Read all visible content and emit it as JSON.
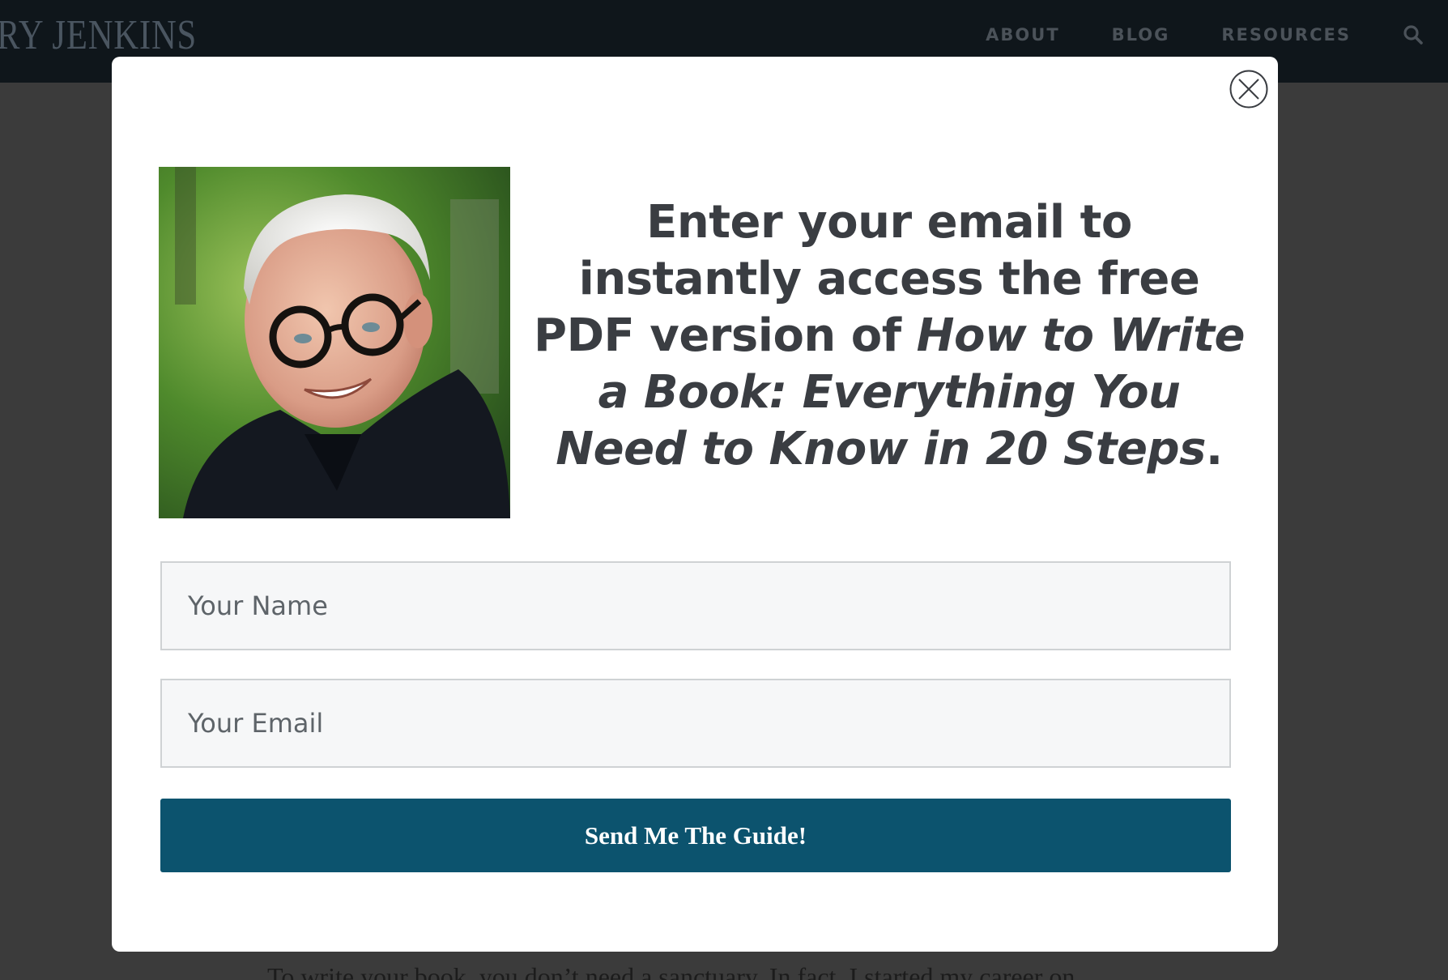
{
  "site": {
    "logo_text": "RY JENKINS",
    "nav": [
      {
        "label": "ABOUT"
      },
      {
        "label": "BLOG"
      },
      {
        "label": "RESOURCES"
      }
    ],
    "background_text": "To write your book, you don’t need a sanctuary. In fact, I started my career on"
  },
  "modal": {
    "headline": {
      "line_plain": "Enter your email to instantly access the free PDF version of",
      "book_title": "How to Write a Book: Everything You Need to Know in 20 Steps",
      "end": "."
    },
    "name_field": {
      "placeholder": "Your Name",
      "value": ""
    },
    "email_field": {
      "placeholder": "Your Email",
      "value": ""
    },
    "submit_label": "Send Me The Guide!"
  },
  "colors": {
    "header_bg": "#0f161b",
    "overlay": "#3b3b3b",
    "button_bg": "#0c536e",
    "headline_text": "#3a3d42"
  },
  "icons": [
    "search-icon",
    "close-icon"
  ]
}
